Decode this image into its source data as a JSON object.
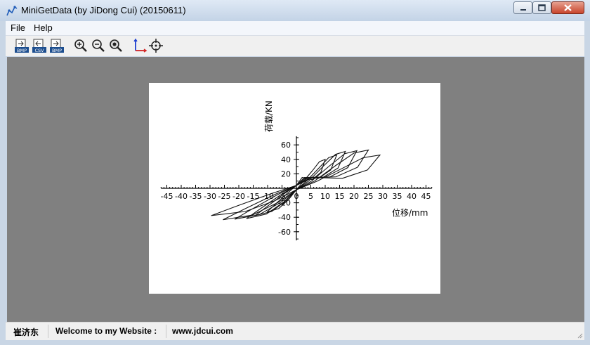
{
  "window": {
    "title": "MiniGetData (by JiDong Cui) (20150611)"
  },
  "menu": [
    "File",
    "Help"
  ],
  "toolbar": [
    {
      "name": "open-bmp-button",
      "icon": "bmp-file-icon",
      "label": "BMP"
    },
    {
      "name": "export-csv-button",
      "icon": "csv-file-icon",
      "label": "CSV"
    },
    {
      "name": "save-bmp-button",
      "icon": "bmp-file-icon",
      "label": "BMP"
    },
    {
      "name": "zoom-in-button",
      "icon": "zoom-in-icon"
    },
    {
      "name": "zoom-out-button",
      "icon": "zoom-out-icon"
    },
    {
      "name": "zoom-fit-button",
      "icon": "zoom-fit-icon"
    },
    {
      "name": "set-axes-button",
      "icon": "axes-icon"
    },
    {
      "name": "pick-point-button",
      "icon": "crosshair-icon"
    }
  ],
  "plot": {
    "ylabel": "荷载/KN",
    "xlabel": "位移/mm",
    "xticks": [
      "-45",
      "-40",
      "-35",
      "-30",
      "-25",
      "-20",
      "-15",
      "-10",
      "-5",
      "0",
      "5",
      "10",
      "15",
      "20",
      "25",
      "30",
      "35",
      "40",
      "45"
    ],
    "yticks": [
      "60",
      "40",
      "20",
      "-20",
      "-40",
      "-60"
    ]
  },
  "status": {
    "author": "崔济东",
    "welcome": "Welcome to my Website :",
    "website": "www.jdcui.com"
  }
}
